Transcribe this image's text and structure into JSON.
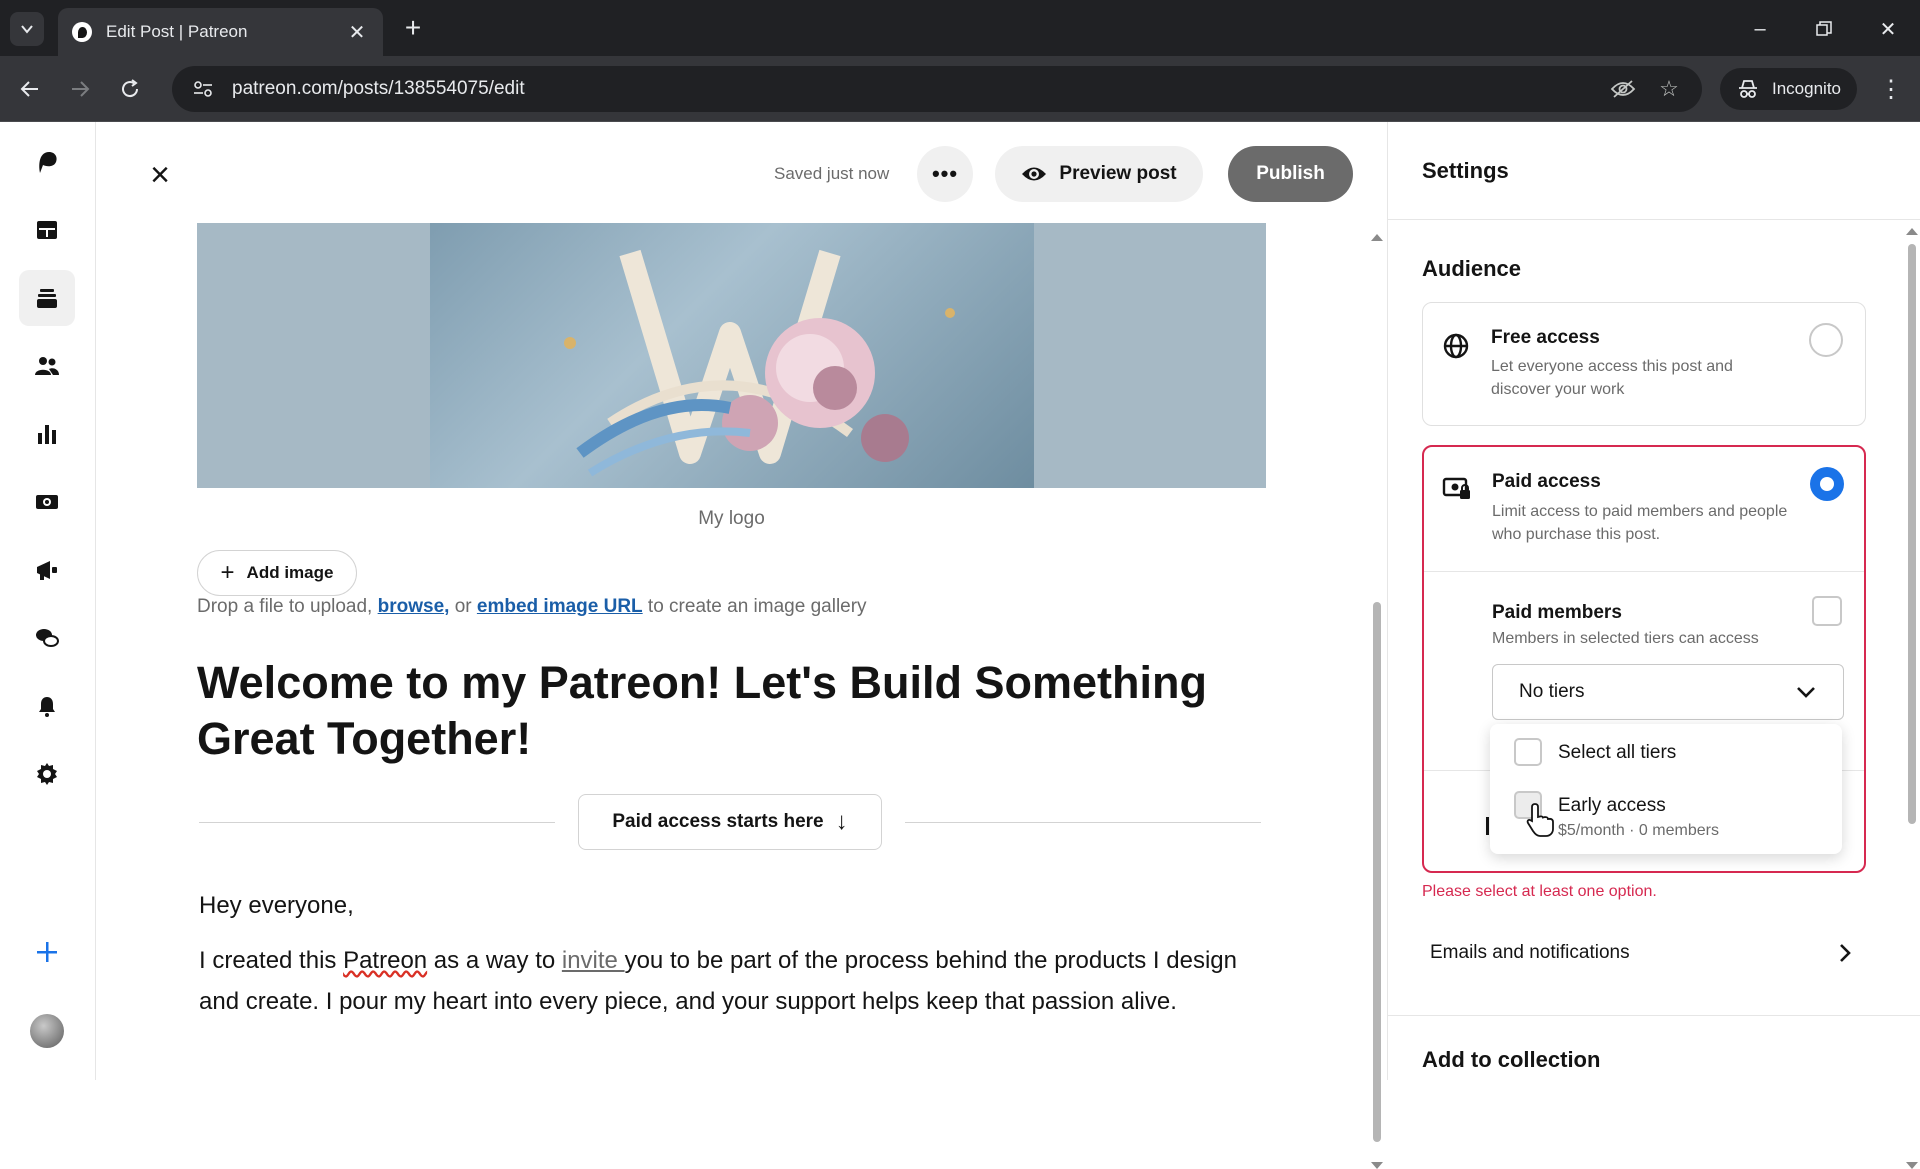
{
  "browser": {
    "tab_title": "Edit Post | Patreon",
    "url": "patreon.com/posts/138554075/edit",
    "incognito_label": "Incognito"
  },
  "rail": {
    "items": [
      "patreon-logo",
      "dashboard",
      "library",
      "audience",
      "insights",
      "payouts",
      "promotions",
      "chats",
      "notifications",
      "settings",
      "create"
    ]
  },
  "editor": {
    "save_status": "Saved just now",
    "more_label": "•••",
    "preview_label": "Preview post",
    "publish_label": "Publish",
    "image_caption": "My logo",
    "add_image_label": "Add image",
    "drop_hint_prefix": "Drop a file to upload, ",
    "browse_link": "browse,",
    "drop_hint_or": " or ",
    "embed_link": "embed image URL",
    "drop_hint_suffix": " to create an image gallery",
    "title": "Welcome to my Patreon! Let's Build Something Great Together!",
    "paid_marker_label": "Paid access starts here",
    "greeting": "Hey everyone,",
    "body_1": "I created this ",
    "body_patreon": "Patreon",
    "body_2": " as a way to ",
    "body_invite": "invite ",
    "body_3": "you to be part of the process behind the products I design and create. I pour my heart into every piece, and your support helps keep that passion alive."
  },
  "settings": {
    "title": "Settings",
    "audience_heading": "Audience",
    "free": {
      "title": "Free access",
      "desc": "Let everyone access this post and discover your work",
      "selected": false
    },
    "paid": {
      "title": "Paid access",
      "desc": "Limit access to paid members and people who purchase this post.",
      "selected": true
    },
    "paid_members": {
      "title": "Paid members",
      "desc": "Members in selected tiers can access",
      "checked": false,
      "tier_select_value": "No tiers"
    },
    "tier_menu": {
      "select_all_label": "Select all tiers",
      "tiers": [
        {
          "name": "Early access",
          "detail": "$5/month · 0 members",
          "checked": false
        }
      ]
    },
    "error_message": "Please select at least one option.",
    "emails_label": "Emails and notifications",
    "collection_heading": "Add to collection"
  },
  "colors": {
    "error": "#d62950",
    "radio_selected": "#1a73e8",
    "link": "#1a5ea8",
    "publish_disabled": "#6b6b6b"
  }
}
